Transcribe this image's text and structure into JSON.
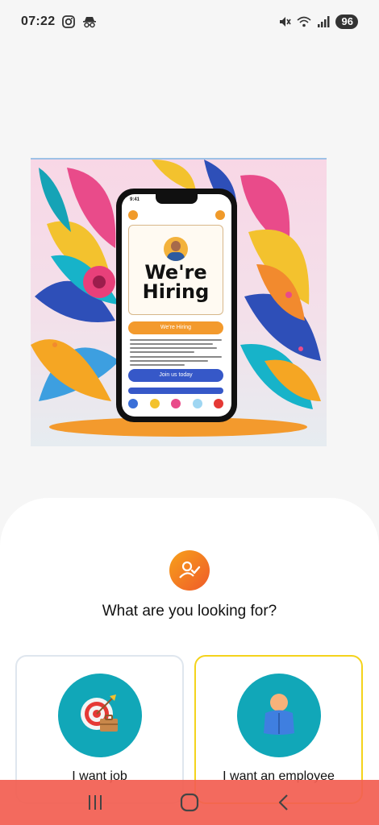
{
  "status_bar": {
    "time": "07:22",
    "battery": "96",
    "left_icons": [
      "instagram-icon",
      "incognito-icon"
    ],
    "right_icons": [
      "mute-icon",
      "wifi-icon",
      "signal-icon",
      "battery-icon"
    ]
  },
  "hero": {
    "phone_time": "9:41",
    "headline_line1": "We're",
    "headline_line2": "Hiring",
    "primary_button": "We're Hiring",
    "secondary_button": "Join us today"
  },
  "sheet": {
    "question": "What are you looking for?",
    "header_icon": "user-check-icon",
    "options": [
      {
        "label": "I want job",
        "icon": "target-briefcase-icon",
        "selected": false
      },
      {
        "label": "I want an employee",
        "icon": "person-icon",
        "selected": true
      }
    ]
  },
  "nav_bar": {
    "buttons": [
      "recents-icon",
      "home-icon",
      "back-icon"
    ]
  },
  "colors": {
    "accent_orange": "#f07a22",
    "teal": "#11a7b8",
    "selected_border": "#f4d31c",
    "nav_bar": "#f25f52"
  }
}
